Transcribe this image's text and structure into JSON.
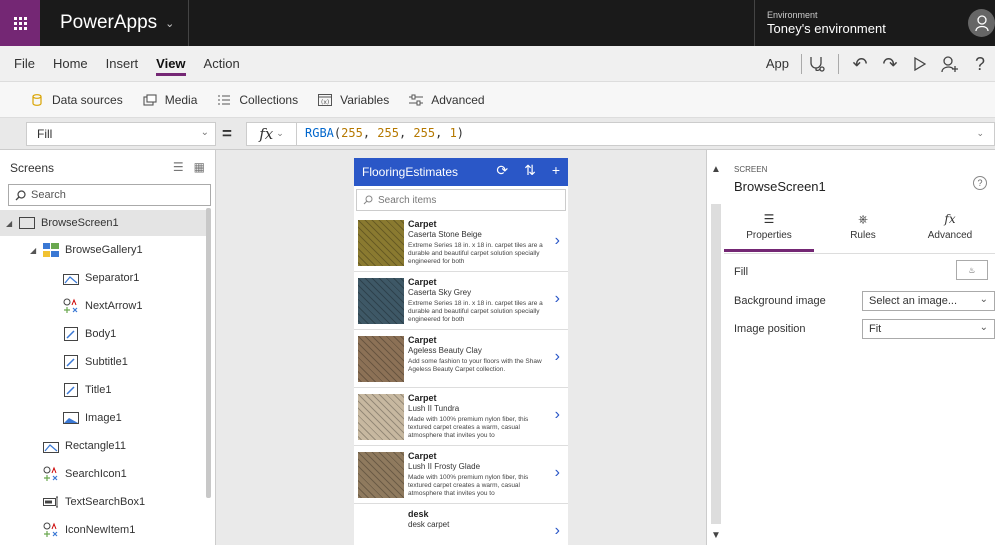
{
  "topbar": {
    "app_name": "PowerApps",
    "env_label": "Environment",
    "env_name": "Toney's environment"
  },
  "menu": {
    "items": [
      "File",
      "Home",
      "Insert",
      "View",
      "Action"
    ],
    "active": "View",
    "app_label": "App"
  },
  "ribbon": {
    "items": [
      "Data sources",
      "Media",
      "Collections",
      "Variables",
      "Advanced"
    ]
  },
  "formula": {
    "property": "Fill",
    "fx": "fx",
    "fn": "RGBA",
    "args": [
      "255",
      "255",
      "255",
      "1"
    ]
  },
  "screens_panel": {
    "title": "Screens",
    "search_placeholder": "Search",
    "tree": [
      {
        "label": "BrowseScreen1",
        "icon": "screen-icon"
      },
      {
        "label": "BrowseGallery1",
        "icon": "gallery-icon"
      },
      {
        "label": "Separator1",
        "icon": "separator-icon"
      },
      {
        "label": "NextArrow1",
        "icon": "icons-icon"
      },
      {
        "label": "Body1",
        "icon": "label-icon"
      },
      {
        "label": "Subtitle1",
        "icon": "label-icon"
      },
      {
        "label": "Title1",
        "icon": "label-icon"
      },
      {
        "label": "Image1",
        "icon": "image-icon"
      },
      {
        "label": "Rectangle11",
        "icon": "shape-icon"
      },
      {
        "label": "SearchIcon1",
        "icon": "icons-icon"
      },
      {
        "label": "TextSearchBox1",
        "icon": "textinput-icon"
      },
      {
        "label": "IconNewItem1",
        "icon": "icons-icon"
      }
    ]
  },
  "app_preview": {
    "title": "FlooringEstimates",
    "search_placeholder": "Search items",
    "items": [
      {
        "title": "Carpet",
        "subtitle": "Caserta Stone Beige",
        "body": "Extreme Series 18 in. x 18 in. carpet tiles are a durable and beautiful carpet solution specially engineered for both",
        "swatch": "#8a7a30"
      },
      {
        "title": "Carpet",
        "subtitle": "Caserta Sky Grey",
        "body": "Extreme Series 18 in. x 18 in. carpet tiles are a durable and beautiful carpet solution specially engineered for both",
        "swatch": "#3e5866"
      },
      {
        "title": "Carpet",
        "subtitle": "Ageless Beauty Clay",
        "body": "Add some fashion to your floors with the Shaw Ageless Beauty Carpet collection.",
        "swatch": "#8c7156"
      },
      {
        "title": "Carpet",
        "subtitle": "Lush II Tundra",
        "body": "Made with 100% premium nylon fiber, this textured carpet creates a warm, casual atmosphere that invites you to",
        "swatch": "#c7b8a0"
      },
      {
        "title": "Carpet",
        "subtitle": "Lush II Frosty Glade",
        "body": "Made with 100% premium nylon fiber, this textured carpet creates a warm, casual atmosphere that invites you to",
        "swatch": "#8f7a5e"
      },
      {
        "title": "desk",
        "subtitle": "desk carpet",
        "body": "",
        "swatch": ""
      }
    ]
  },
  "properties_panel": {
    "caption": "SCREEN",
    "name": "BrowseScreen1",
    "tabs": [
      "Properties",
      "Rules",
      "Advanced"
    ],
    "active_tab": "Properties",
    "rows": [
      {
        "label": "Fill"
      },
      {
        "label": "Background image",
        "value": "Select an image..."
      },
      {
        "label": "Image position",
        "value": "Fit"
      }
    ]
  },
  "colors": {
    "brand": "#742774",
    "header": "#2a57c7",
    "topbar": "#1a1a1a"
  }
}
